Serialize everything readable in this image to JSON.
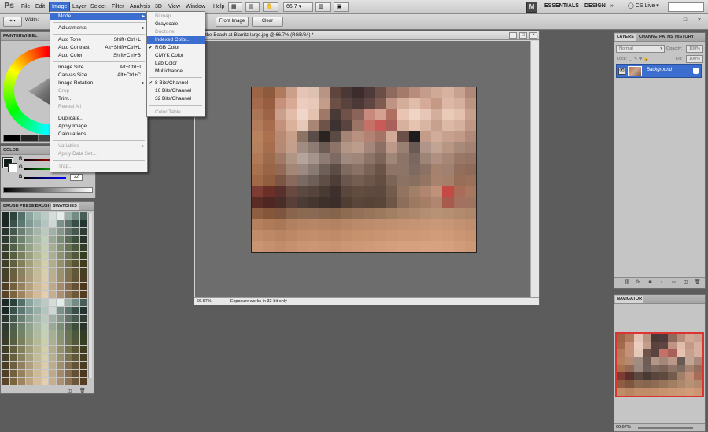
{
  "app": {
    "logo": "Ps",
    "menus": [
      "File",
      "Edit",
      "Image",
      "Layer",
      "Select",
      "Filter",
      "Analysis",
      "3D",
      "View",
      "Window",
      "Help"
    ],
    "active_menu": "Image",
    "zoom_box": "66.7",
    "workspaces": [
      "ESSENTIALS",
      "DESIGN"
    ],
    "cs_live": "CS Live",
    "window_controls": [
      "–",
      "□",
      "×"
    ]
  },
  "options_bar": {
    "width_label": "Width:",
    "front_image": "Front Image",
    "clear": "Clear"
  },
  "image_menu": {
    "items": [
      {
        "label": "Mode",
        "submenu": true,
        "highlight": true
      },
      {
        "label": "Adjustments",
        "submenu": true
      },
      {
        "label": "Auto Tone",
        "shortcut": "Shift+Ctrl+L"
      },
      {
        "label": "Auto Contrast",
        "shortcut": "Alt+Shift+Ctrl+L"
      },
      {
        "label": "Auto Color",
        "shortcut": "Shift+Ctrl+B"
      },
      {
        "label": "Image Size...",
        "shortcut": "Alt+Ctrl+I"
      },
      {
        "label": "Canvas Size...",
        "shortcut": "Alt+Ctrl+C"
      },
      {
        "label": "Image Rotation",
        "submenu": true
      },
      {
        "label": "Crop",
        "disabled": true
      },
      {
        "label": "Trim..."
      },
      {
        "label": "Reveal All",
        "disabled": true
      },
      {
        "label": "Duplicate..."
      },
      {
        "label": "Apply Image..."
      },
      {
        "label": "Calculations..."
      },
      {
        "label": "Variables",
        "submenu": true,
        "disabled": true
      },
      {
        "label": "Apply Data Set...",
        "disabled": true
      },
      {
        "label": "Trap...",
        "disabled": true
      }
    ]
  },
  "mode_menu": {
    "items": [
      {
        "label": "Bitmap",
        "disabled": true
      },
      {
        "label": "Grayscale"
      },
      {
        "label": "Duotone",
        "disabled": true
      },
      {
        "label": "Indexed Color...",
        "highlight": true
      },
      {
        "label": "RGB Color",
        "checked": true
      },
      {
        "label": "CMYK Color"
      },
      {
        "label": "Lab Color"
      },
      {
        "label": "Multichannel"
      },
      {
        "label": "8 Bits/Channel",
        "checked": true
      },
      {
        "label": "16 Bits/Channel"
      },
      {
        "label": "32 Bits/Channel"
      },
      {
        "label": "Color Table...",
        "disabled": true
      }
    ]
  },
  "document": {
    "title": "the-Beach-at-Biarritz-large.jpg @ 66.7% (RGB/8#) *",
    "zoom": "66.67%",
    "status": "Exposure works in 32-bit only",
    "mosaic_colors": [
      "#9c6646",
      "#8e5a3e",
      "#b07a5c",
      "#cba08a",
      "#e4c4b4",
      "#dcc0b0",
      "#b89484",
      "#5e463e",
      "#4a3836",
      "#3c2c2c",
      "#4e3a3a",
      "#6a4e48",
      "#8e6a5e",
      "#a47a6a",
      "#b88c7a",
      "#c49c8c",
      "#cfa896",
      "#d8b2a0",
      "#c8a290",
      "#b08878",
      "#a46a4c",
      "#985e42",
      "#c6907a",
      "#d8aa96",
      "#ecccbe",
      "#e8c8b8",
      "#c49c8a",
      "#6c5046",
      "#5a423e",
      "#4c3836",
      "#604642",
      "#7e5a50",
      "#c09484",
      "#d4ac9a",
      "#e0bcaa",
      "#d6aa98",
      "#c69886",
      "#deb8a6",
      "#d6b09e",
      "#bc9482",
      "#aa7456",
      "#9e6448",
      "#caa08a",
      "#e2bca8",
      "#f0d6c8",
      "#e4c2b0",
      "#a07868",
      "#4a3a36",
      "#70524a",
      "#8a6458",
      "#c88a7e",
      "#d4a090",
      "#b07060",
      "#e8c4b2",
      "#f0d4c4",
      "#e6c6b6",
      "#d4ae9c",
      "#eacab8",
      "#e4c0ae",
      "#c8a08e",
      "#b27c5c",
      "#a66c4c",
      "#c4927a",
      "#dab29c",
      "#e6c8b8",
      "#a88676",
      "#6e5448",
      "#3c3230",
      "#5a4440",
      "#9a7464",
      "#c47268",
      "#c85a58",
      "#a8605a",
      "#d8b09e",
      "#e6c2b0",
      "#d8b4a2",
      "#c8a08e",
      "#dcb8a6",
      "#d6b09e",
      "#c09684",
      "#b8825e",
      "#ac7250",
      "#b88a72",
      "#c8a08a",
      "#8c7464",
      "#5a4c46",
      "#2c2422",
      "#5a4a44",
      "#a48474",
      "#b89080",
      "#b48272",
      "#a47466",
      "#d2aa98",
      "#6a5048",
      "#1e1c1c",
      "#c49c8a",
      "#d2ac9a",
      "#c8a08e",
      "#c29a88",
      "#b08a78",
      "#b4805e",
      "#a66e4e",
      "#b68a72",
      "#c4a08c",
      "#a08c80",
      "#8e7c74",
      "#6c5c54",
      "#8c7468",
      "#b49686",
      "#bc9c8c",
      "#a4867a",
      "#8c7064",
      "#bc9888",
      "#988074",
      "#6a5a54",
      "#b0968a",
      "#c2a494",
      "#b89684",
      "#a88a7a",
      "#a48272",
      "#b07a58",
      "#9e6a4c",
      "#a07a66",
      "#b09484",
      "#b4a49c",
      "#a4948c",
      "#8c7c74",
      "#7c6a62",
      "#a08a80",
      "#a08678",
      "#8c7468",
      "#7c6458",
      "#a08676",
      "#8c7468",
      "#7a6860",
      "#9c8476",
      "#b09080",
      "#a88676",
      "#9a7868",
      "#967464",
      "#a8724e",
      "#9a6446",
      "#926a56",
      "#a48676",
      "#9c8a82",
      "#8a7a74",
      "#6e6058",
      "#5c4c46",
      "#806a60",
      "#8a7266",
      "#7a6256",
      "#6a5448",
      "#8e7466",
      "#8c7466",
      "#7e6a60",
      "#8c7264",
      "#a4826e",
      "#a08070",
      "#946e5c",
      "#8e6a58",
      "#a06a48",
      "#925e40",
      "#7c5644",
      "#8a6a5c",
      "#7a6a64",
      "#6e6058",
      "#5e4e46",
      "#4e3e38",
      "#6a564c",
      "#745e52",
      "#6c564a",
      "#644e42",
      "#7c6456",
      "#8c7262",
      "#887060",
      "#947462",
      "#a8826c",
      "#a4806a",
      "#986e58",
      "#9a7058",
      "#7e3c34",
      "#6a3028",
      "#5a302c",
      "#6a4a40",
      "#5c4840",
      "#54443c",
      "#4a3a34",
      "#3e302c",
      "#5a463c",
      "#624c40",
      "#5e4a3e",
      "#5c4a3e",
      "#745c4c",
      "#927460",
      "#a08068",
      "#b08670",
      "#c09078",
      "#c44a44",
      "#a86c58",
      "#a8785e",
      "#5a2c26",
      "#4e2622",
      "#4a2c28",
      "#584038",
      "#4c3c36",
      "#463630",
      "#3e302a",
      "#3c2e2a",
      "#503e34",
      "#5a463a",
      "#584436",
      "#5a4638",
      "#6e5646",
      "#8c6e5a",
      "#9c7a62",
      "#a67e66",
      "#b08670",
      "#a85a4c",
      "#a47060",
      "#9e7460",
      "#8e5e42",
      "#84563a",
      "#7e5640",
      "#8a644c",
      "#8c6a52",
      "#8a6a54",
      "#86664e",
      "#86644c",
      "#8e6c52",
      "#947058",
      "#98745a",
      "#9c785c",
      "#a27e62",
      "#aa8468",
      "#ae886c",
      "#b48e72",
      "#b89274",
      "#b68e72",
      "#b28a6e",
      "#ae866a",
      "#b4805e",
      "#ae7a58",
      "#aa7856",
      "#b08060",
      "#b48464",
      "#b68666",
      "#b48464",
      "#b28262",
      "#b68666",
      "#ba8a6a",
      "#bc8c6c",
      "#be8e6e",
      "#c09070",
      "#c29272",
      "#c49474",
      "#c69676",
      "#c89878",
      "#c69676",
      "#c29272",
      "#be8e6e",
      "#c08c6a",
      "#bc8866",
      "#b88462",
      "#bc8866",
      "#c08c6a",
      "#c28e6c",
      "#c08c6a",
      "#be8a68",
      "#c28e6c",
      "#c6926e",
      "#c69270",
      "#c89472",
      "#ca9674",
      "#cc9876",
      "#cc9876",
      "#ce9a78",
      "#d09c7a",
      "#ce9a78",
      "#ca9674",
      "#c69270",
      "#c89472",
      "#c4906e",
      "#c08c6a",
      "#c4906e",
      "#c89472",
      "#ca9674",
      "#c89472",
      "#c69270",
      "#ca9674",
      "#cc9876",
      "#ce9a78",
      "#d09c7a",
      "#d29e7c",
      "#d4a07e",
      "#d4a07e",
      "#d6a280",
      "#d6a280",
      "#d4a07e",
      "#d09c7a",
      "#cc9876"
    ]
  },
  "left_panels": {
    "painterwheel_tab": "PAINTERWHEEL",
    "color_tab": "COLOR",
    "color_value_b": "22",
    "swatch_tabs": [
      "BRUSH PRESET",
      "BRUSH",
      "SWATCHES"
    ],
    "swatches": [
      "#1c2a26",
      "#2e423c",
      "#54706a",
      "#8ca49e",
      "#a8bcb6",
      "#bccac4",
      "#d4ded8",
      "#e4ece8",
      "#9cb0aa",
      "#748a84",
      "#4a5e58",
      "#1a2824",
      "#3a504a",
      "#5c7872",
      "#7e9892",
      "#98aea8",
      "#b4c4be",
      "#ccd8d2",
      "#7a908a",
      "#5c726c",
      "#3a4e48",
      "#243430",
      "#283630",
      "#46584e",
      "#6a7e72",
      "#8a9e92",
      "#a4b6aa",
      "#bccabe",
      "#a0b2a6",
      "#84968a",
      "#62746a",
      "#48584e",
      "#2e3c34",
      "#2c3a30",
      "#4c5e4e",
      "#6e826e",
      "#8ea28e",
      "#aabaa6",
      "#c2d0be",
      "#98aa94",
      "#7a8c76",
      "#5a6c58",
      "#3e4e3c",
      "#28342a",
      "#343e2c",
      "#52604a",
      "#748268",
      "#94a288",
      "#b0bca2",
      "#c6d0b8",
      "#a4b092",
      "#869274",
      "#687456",
      "#4c583c",
      "#323c26",
      "#3a3e28",
      "#585e40",
      "#7a805e",
      "#9aa07e",
      "#b4ba98",
      "#cad0ae",
      "#aab090",
      "#8c9272",
      "#6e7454",
      "#52583a",
      "#383e24",
      "#403e26",
      "#605e3c",
      "#82805a",
      "#a2a07a",
      "#bcba96",
      "#d2d0ac",
      "#b2ae8a",
      "#94906c",
      "#76724e",
      "#5a5634",
      "#403c20",
      "#44402a",
      "#66603e",
      "#888260",
      "#a8a280",
      "#c2bc9a",
      "#d6d0ae",
      "#b8b08c",
      "#9a926e",
      "#7c7450",
      "#605836",
      "#463e22",
      "#4a3e28",
      "#6c5e3e",
      "#8e8060",
      "#ae9e7e",
      "#c6b898",
      "#dacdae",
      "#bcae8c",
      "#9e8e6c",
      "#80704e",
      "#645436",
      "#4a3c22",
      "#503e26",
      "#72603e",
      "#94825e",
      "#b4a07e",
      "#ccba98",
      "#dccaac",
      "#c0a888",
      "#a28a6a",
      "#846c4e",
      "#665034",
      "#4c381e",
      "#5a4428",
      "#7c6440",
      "#9e8460",
      "#bea480",
      "#d4bc9a",
      "#e2ceb0",
      "#c8ae8c",
      "#aa9070",
      "#8c7252",
      "#6e5638",
      "#543e22"
    ]
  },
  "layers_panel": {
    "tabs": [
      "LAYERS",
      "CHANNE",
      "PATHS",
      "HISTORY"
    ],
    "blend_mode": "Normal",
    "opacity_label": "Opacity:",
    "opacity": "100%",
    "lock_label": "Lock:",
    "fill_label": "Fill:",
    "fill": "100%",
    "layer_name": "Background"
  },
  "navigator_panel": {
    "tab": "NAVIGATOR",
    "zoom": "66.67%"
  }
}
